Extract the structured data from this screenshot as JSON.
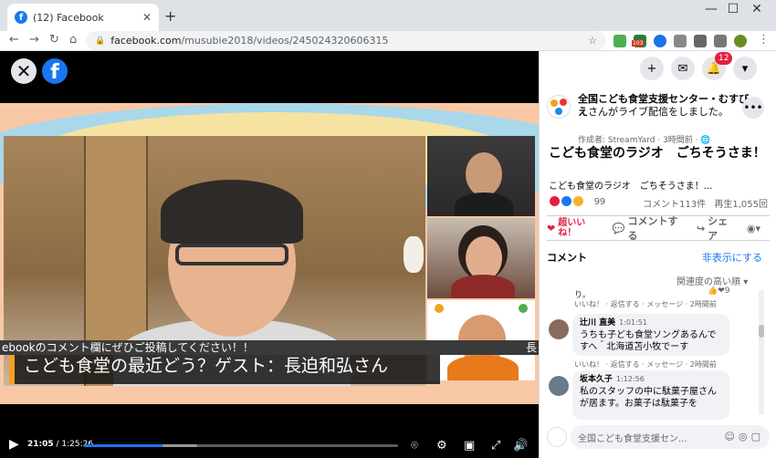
{
  "browser": {
    "tab_title": "(12) Facebook",
    "favicon_letter": "f",
    "new_tab": "+",
    "url_host": "facebook.com",
    "url_path": "/musubie2018/videos/245024320606315",
    "ext_badge": "103",
    "window_min": "—",
    "window_max": "☐",
    "window_close": "✕",
    "tab_close": "✕"
  },
  "player": {
    "close_glyph": "✕",
    "logo_letter": "f",
    "caption": "こども食堂の最近どう？ゲスト：長迫和弘さん",
    "ticker": "ebookのコメント欄にぜひご投稿してください！！",
    "ticker_right": "長",
    "time_current": "21:05",
    "time_total": "1:25:26",
    "progress_fraction": 0.25,
    "buffer_fraction": 0.36
  },
  "topnav": {
    "notification_count": "12"
  },
  "post": {
    "author": "全国こども食堂支援センター・むすびえ",
    "author_suffix": "さんがライブ配信をしました。",
    "meta": "作成者: StreamYard · 3時間前 · 🌐",
    "title": "こども食堂のラジオ　ごちそうさま！",
    "desc": "こども食堂のラジオ　ごちそうさま！...",
    "reaction_count": "99",
    "comment_count": "コメント113件",
    "view_count": "再生1,055回",
    "like_label": "超いいね！",
    "comment_label": "コメントする",
    "share_label": "シェア"
  },
  "comments_section": {
    "heading": "コメント",
    "hide": "非表示にする",
    "sort": "関連度の高い順",
    "fragment_text": "り。",
    "fragment_reactions": "9",
    "fragment_meta": "いいね！ · 返信する · メッセージ · 2時間前",
    "items": [
      {
        "name": "辻川 直美",
        "time": "1:01:51",
        "text": "うちも子ども食堂ソングあるんですへ＾北海道苫小牧でーす",
        "meta": "いいね！ · 返信する · メッセージ · 2時間前"
      },
      {
        "name": "坂本久子",
        "time": "1:12:56",
        "text": "私のスタッフの中に駄菓子屋さんが居ます。お菓子は駄菓子を",
        "meta": ""
      }
    ],
    "compose_placeholder": "全国こども食堂支援セン..."
  }
}
